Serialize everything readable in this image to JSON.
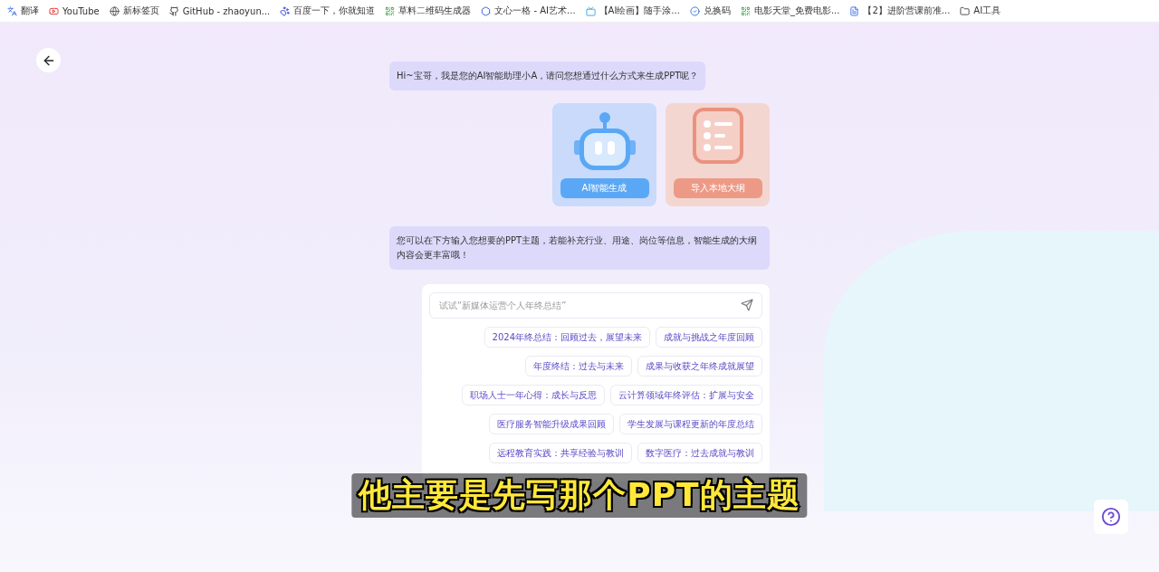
{
  "bookmarks": [
    {
      "label": "翻译",
      "kind": "translate"
    },
    {
      "label": "YouTube",
      "kind": "youtube"
    },
    {
      "label": "新标签页",
      "kind": "globe"
    },
    {
      "label": "GitHub - zhaoyun...",
      "kind": "github"
    },
    {
      "label": "百度一下，你就知道",
      "kind": "paw"
    },
    {
      "label": "草料二维码生成器",
      "kind": "qr"
    },
    {
      "label": "文心一格 - AI艺术...",
      "kind": "hex"
    },
    {
      "label": "【AI绘画】随手涂...",
      "kind": "tv"
    },
    {
      "label": "兑换码",
      "kind": "check"
    },
    {
      "label": "电影天堂_免费电影...",
      "kind": "qr"
    },
    {
      "label": "【2】进阶营课前准...",
      "kind": "doc"
    },
    {
      "label": "AI工具",
      "kind": "folder"
    }
  ],
  "greeting": "Hi~宝哥，我是您的AI智能助理小A，请问您想通过什么方式来生成PPT呢？",
  "options": [
    {
      "label": "AI智能生成",
      "kind": "robot"
    },
    {
      "label": "导入本地大纲",
      "kind": "outline"
    }
  ],
  "hint": "您可以在下方输入您想要的PPT主题，若能补充行业、用途、岗位等信息，智能生成的大纲内容会更丰富哦！",
  "input": {
    "placeholder": "试试“新媒体运营个人年终总结”"
  },
  "suggestion_rows": [
    [
      "2024年终总结：回顾过去，展望未来",
      "成就与挑战之年度回顾"
    ],
    [
      "年度终结：过去与未来",
      "成果与收获之年终成就展望"
    ],
    [
      "职场人士一年心得：成长与反思",
      "云计算领域年终评估：扩展与安全"
    ],
    [
      "医疗服务智能升级成果回顾",
      "学生发展与课程更新的年度总结"
    ],
    [
      "远程教育实践：共享经验与教训",
      "数字医疗：过去成就与教训"
    ]
  ],
  "subtitle": "他主要是先写那个PPT的主题"
}
